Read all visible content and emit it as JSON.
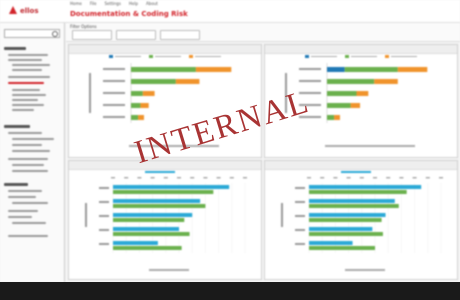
{
  "app": {
    "logo_text": "ellos",
    "page_title": "Documentation & Coding Risk",
    "menu": [
      "Home",
      "File",
      "Settings",
      "Help",
      "About"
    ]
  },
  "filters": {
    "label": "Filter Options"
  },
  "watermark": {
    "text": "INTERNAL"
  },
  "colors": {
    "brand_red": "#d2232a",
    "series_blue": "#1f78b4",
    "series_green": "#6ab04c",
    "series_orange": "#f0932b",
    "series_teal": "#2aa9d6",
    "watermark": "#a52a2a"
  },
  "chart_data": [
    {
      "type": "bar",
      "orientation": "horizontal",
      "stacked": true,
      "categories": [
        "A",
        "B",
        "C",
        "D",
        "E"
      ],
      "series": [
        {
          "color": "#1f78b4",
          "values": [
            0,
            0,
            0,
            0,
            0
          ]
        },
        {
          "color": "#6ab04c",
          "values": [
            55,
            38,
            10,
            8,
            6
          ]
        },
        {
          "color": "#f0932b",
          "values": [
            30,
            20,
            10,
            7,
            5
          ]
        }
      ]
    },
    {
      "type": "bar",
      "orientation": "horizontal",
      "stacked": true,
      "categories": [
        "A",
        "B",
        "C",
        "D",
        "E"
      ],
      "series": [
        {
          "color": "#1f78b4",
          "values": [
            15,
            0,
            0,
            0,
            0
          ]
        },
        {
          "color": "#6ab04c",
          "values": [
            45,
            40,
            25,
            20,
            6
          ]
        },
        {
          "color": "#f0932b",
          "values": [
            25,
            20,
            10,
            8,
            5
          ]
        }
      ]
    },
    {
      "type": "bar",
      "orientation": "horizontal",
      "grouped": true,
      "categories": [
        "A",
        "B",
        "C",
        "D",
        "E"
      ],
      "series": [
        {
          "color": "#2aa9d6",
          "values": [
            88,
            66,
            60,
            50,
            34
          ]
        },
        {
          "color": "#6ab04c",
          "values": [
            76,
            70,
            54,
            58,
            52
          ]
        }
      ]
    },
    {
      "type": "bar",
      "orientation": "horizontal",
      "grouped": true,
      "categories": [
        "A",
        "B",
        "C",
        "D",
        "E"
      ],
      "series": [
        {
          "color": "#2aa9d6",
          "values": [
            85,
            65,
            58,
            48,
            33
          ]
        },
        {
          "color": "#6ab04c",
          "values": [
            74,
            68,
            55,
            56,
            50
          ]
        }
      ]
    }
  ]
}
